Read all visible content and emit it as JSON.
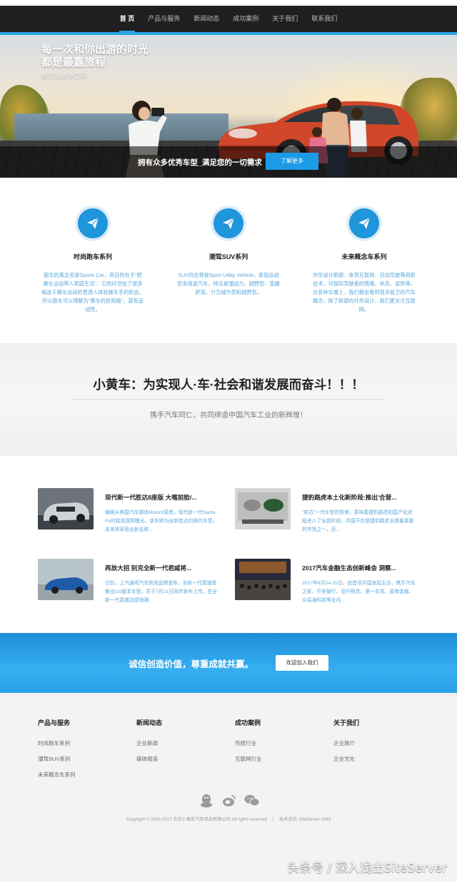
{
  "nav": {
    "items": [
      {
        "label": "首 页",
        "active": true
      },
      {
        "label": "产品与服务"
      },
      {
        "label": "新闻动态"
      },
      {
        "label": "成功案例"
      },
      {
        "label": "关于我们"
      },
      {
        "label": "联系我们"
      }
    ]
  },
  "hero": {
    "title_line1": "每一次和你出游的时光",
    "title_line2": "都是最嘉旅程",
    "subtitle": "给生活更多空间",
    "bar_text": "拥有众多优秀车型_满足您的一切需求",
    "button": "了解更多"
  },
  "features": [
    {
      "icon": "paper-plane-icon",
      "title": "时尚跑车系列",
      "desc": "跑车的英文名是Sports Car，其目的在于\"把赛车运动带入家庭生活\"，它的问世给了很多痴迷于赛车运动的普通人体验赛车手的机会。所以跑车可以理解为\"赛车的民用版\"，富有运动性。"
    },
    {
      "icon": "paper-plane-icon",
      "title": "潮驾SUV系列",
      "desc": "SUV的全称是Sport Utility Vehicle，是指运动型多用途汽车，特点是强动力、越野型、宽敞舒适，分为城市型和越野型。"
    },
    {
      "icon": "paper-plane-icon",
      "title": "未来概念车系列",
      "desc": "外形设计新颖、体现互联网、自动驾驶等高新技术，可探知驾驶者的情绪、状态、姿势等，在各种车展上，我们都会看到很多前卫的汽车概念，除了新颖的外形设计，我们更关注互联网。"
    }
  ],
  "slogan": {
    "title": "小黄车：为实现人·车·社会和谐发展而奋斗！！！",
    "subtitle": "携手汽车同仁，共同缔造中国汽车工业的新辉煌！"
  },
  "news": [
    {
      "title": "现代新一代胜达8座版 大嘴前脸/...",
      "desc": "编辑从美国汽车媒体Motor1获悉，现代新一代Santa Fe的路测谍照曝光，该车即为全新胜达的换代车型，未来将采用全新名称..."
    },
    {
      "title": "捷豹路虎本土化新阶段:推出'合营...",
      "desc": "\"奕芯\"一代车型的到来，意味着捷豹路虎的国产化进程进入了全新阶段，中国不仅是捷豹路虎全球最重要的市场之一，还..."
    },
    {
      "title": "再放大招 别克全新一代君威将...",
      "desc": "日前，上汽通用汽车别克品牌宣布，全新一代君威将推出GS版本车型，并于7月21日同步发布上市。在全新一代君威动感饱满..."
    },
    {
      "title": "2017汽车金融生态创新峰会 洞察...",
      "desc": "2017年8月24-25日，由首讯中国发起主办，携手汽车之家、平安银行、佰仟租赁、第一车贷、易商金融、众易通科技等业内..."
    }
  ],
  "cta": {
    "text": "诚信创造价值，尊重成就共赢。",
    "button": "欢迎加入我们"
  },
  "footer": {
    "columns": [
      {
        "title": "产品与服务",
        "links": [
          "时尚跑车系列",
          "潮驾SUV系列",
          "未来概念车系列"
        ]
      },
      {
        "title": "新闻动态",
        "links": [
          "企业新闻",
          "媒体报道"
        ]
      },
      {
        "title": "成功案例",
        "links": [
          "传统行业",
          "互联网行业"
        ]
      },
      {
        "title": "关于我们",
        "links": [
          "企业简介",
          "企业文化"
        ]
      }
    ],
    "social": [
      "qq-icon",
      "weibo-icon",
      "wechat-icon"
    ],
    "copyright": "Copyright © 2003-2017 北京小黄车汽车用品有限公司 All rights reserved",
    "tech": "技术支持: SiteServer CMS"
  },
  "watermark": "头条号 / 深入浅出SiteServer",
  "colors": {
    "accent": "#2aa3e4",
    "nav_bg": "#1f1f1f",
    "link_blue": "#5aa7dc"
  }
}
